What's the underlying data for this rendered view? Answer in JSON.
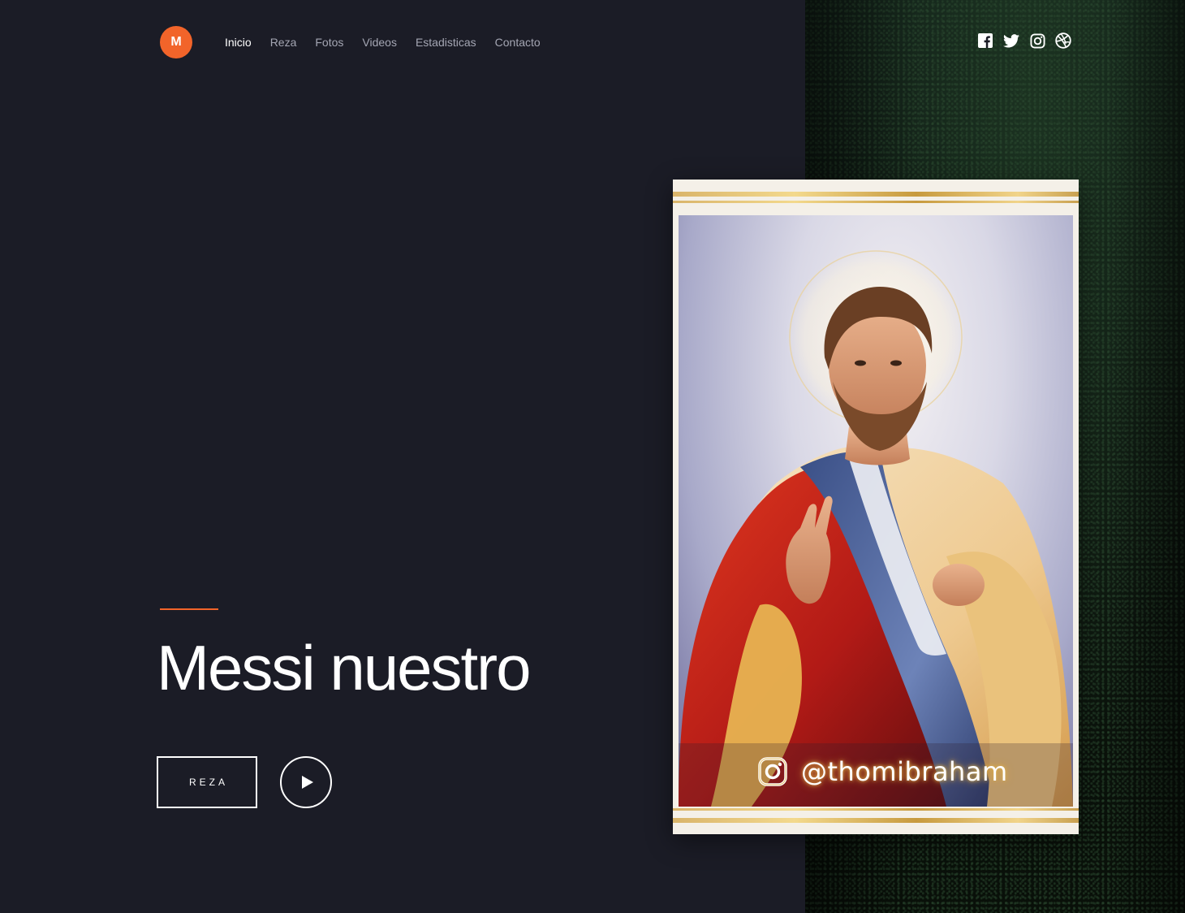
{
  "header": {
    "logo_letter": "M",
    "nav": [
      {
        "label": "Inicio",
        "active": true
      },
      {
        "label": "Reza",
        "active": false
      },
      {
        "label": "Fotos",
        "active": false
      },
      {
        "label": "Videos",
        "active": false
      },
      {
        "label": "Estadisticas",
        "active": false
      },
      {
        "label": "Contacto",
        "active": false
      }
    ],
    "social_icons": [
      "facebook-icon",
      "twitter-icon",
      "instagram-icon",
      "dribbble-icon"
    ]
  },
  "hero": {
    "title": "Messi nuestro",
    "primary_button_label": "REZA",
    "play_icon": "play-icon"
  },
  "image": {
    "watermark_handle": "@thomibraham",
    "watermark_icon": "instagram-icon"
  },
  "colors": {
    "background": "#1b1c26",
    "accent": "#f2642a",
    "nav_inactive": "#a4a6b3",
    "text": "#ffffff"
  }
}
